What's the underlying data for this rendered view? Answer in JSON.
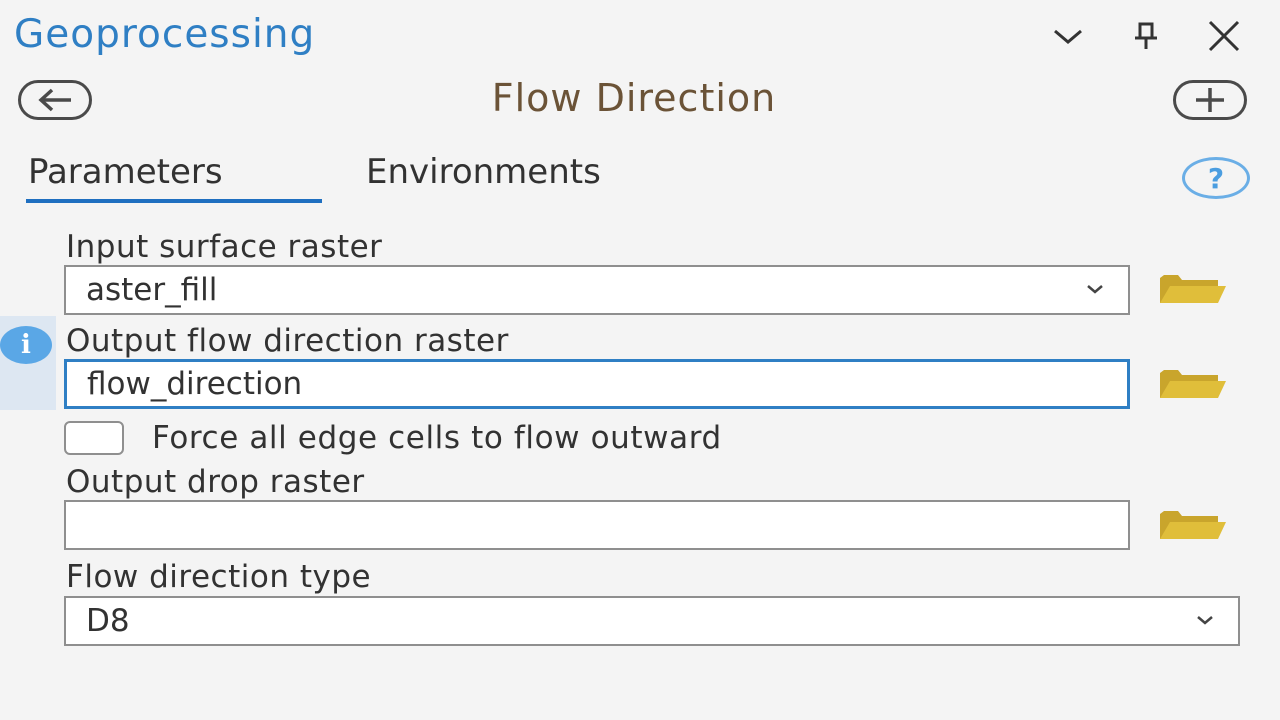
{
  "header": {
    "pane_title": "Geoprocessing",
    "tool_title": "Flow Direction"
  },
  "icons": {
    "options": "chevron-down-icon",
    "pin": "pin-icon",
    "close": "close-icon",
    "back": "back-arrow-icon",
    "add": "add-icon",
    "help": "help-icon",
    "info": "info-icon",
    "folder": "folder-icon"
  },
  "tabs": [
    {
      "label": "Parameters",
      "active": true
    },
    {
      "label": "Environments",
      "active": false
    }
  ],
  "help_glyph": "?",
  "info_glyph": "i",
  "params": {
    "input_surface": {
      "label": "Input surface raster",
      "value": "aster_fill"
    },
    "output_flow": {
      "label": "Output flow direction raster",
      "value": "flow_direction"
    },
    "force_edge": {
      "label": "Force all edge cells to flow outward",
      "checked": false
    },
    "output_drop": {
      "label": "Output drop raster",
      "value": ""
    },
    "flow_type": {
      "label": "Flow direction type",
      "value": "D8"
    }
  },
  "colors": {
    "accent_blue": "#2f7fc4",
    "folder_yellow": "#e0be3a",
    "title_brown": "#6b5337"
  }
}
